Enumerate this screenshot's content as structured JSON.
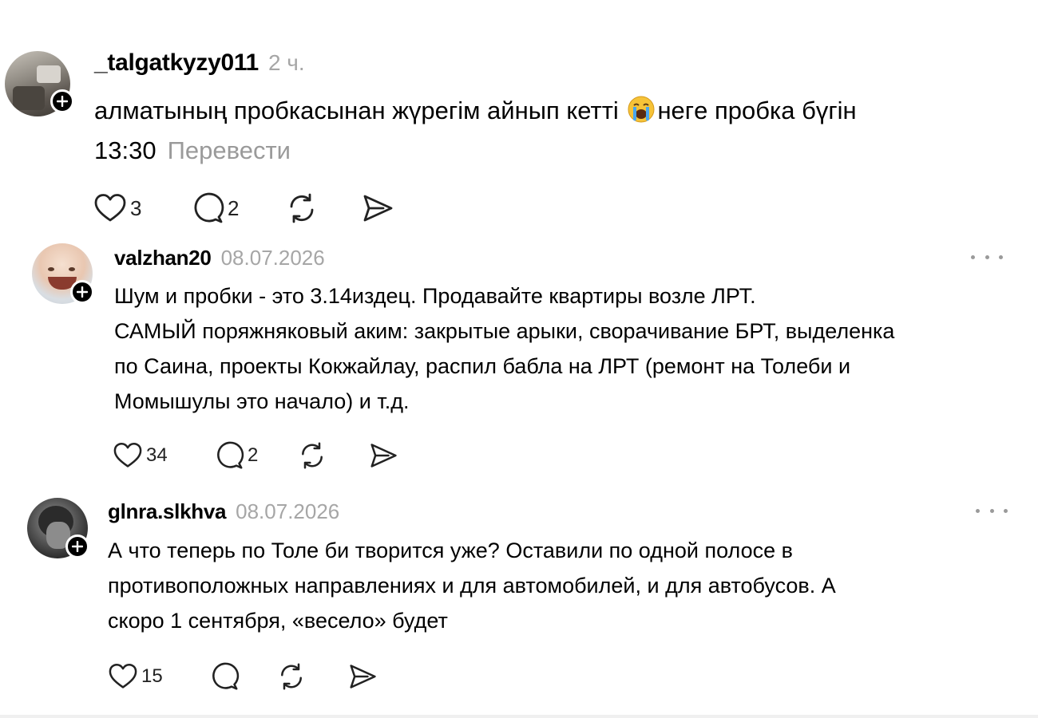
{
  "posts": [
    {
      "username": "_talgatkyzy011",
      "time": "2 ч.",
      "lines": [
        "алматының пробкасынан жүрегім айнып кетті",
        "негe пробка бүгін",
        "13:30"
      ],
      "emoji": "loudly-crying-face",
      "translate_label": "Перевести",
      "likes": "3",
      "replies": "2"
    },
    {
      "username": "valzhan20",
      "time": "08.07.2026",
      "lines": [
        "Шум и пробки - это 3.14издец. Продавайте квартиры возле ЛРТ.",
        "САМЫЙ поряжняковый аким: закрытые арыки, сворачивание БРТ, выделенка",
        "по Саина, проекты Кокжайлау, распил бабла на ЛРТ (ремонт на Толеби и",
        "Момышулы это начало) и т.д."
      ],
      "likes": "34",
      "replies": "2"
    },
    {
      "username": "glnra.slkhva",
      "time": "08.07.2026",
      "lines": [
        "А что теперь по Толе би творится уже? Оставили по одной полосе в",
        "противоположных направлениях и для автомобилей, и для автобусов. А",
        "скоро 1 сентября, «весело» будет"
      ],
      "likes": "15",
      "replies": ""
    }
  ],
  "icons": {
    "like": "heart-icon",
    "reply": "comment-icon",
    "repost": "repost-icon",
    "share": "send-icon",
    "follow": "plus-icon",
    "more": "more-icon"
  }
}
